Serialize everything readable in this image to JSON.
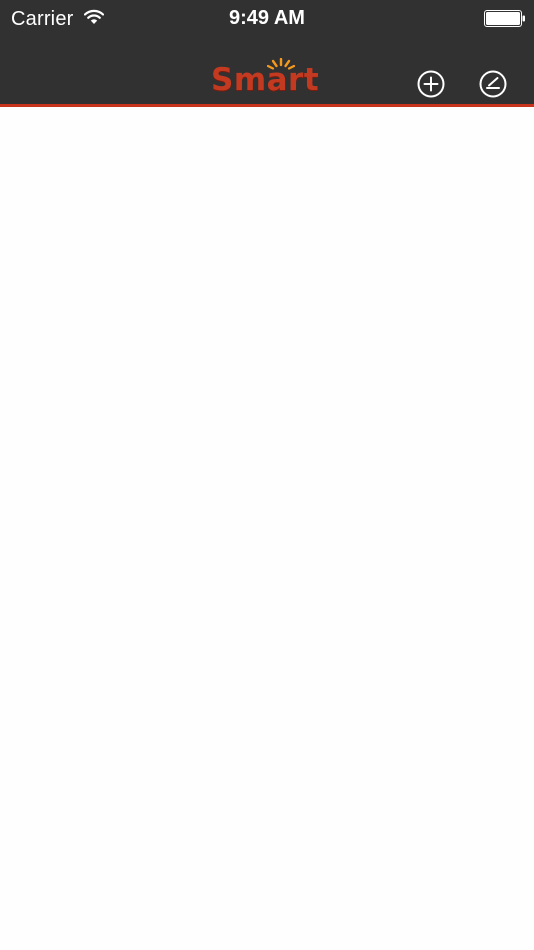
{
  "status_bar": {
    "carrier": "Carrier",
    "time": "9:49 AM",
    "wifi_icon": "wifi-icon",
    "battery_icon": "battery-full-icon"
  },
  "nav_bar": {
    "logo_text": "Smart",
    "add_icon": "plus-circle-icon",
    "edit_icon": "edit-circle-icon"
  },
  "colors": {
    "nav_background": "#313131",
    "accent_border": "#c8331c",
    "logo_red": "#c43a20",
    "logo_rays": "#f39a1e",
    "content_background": "#fefefe"
  }
}
